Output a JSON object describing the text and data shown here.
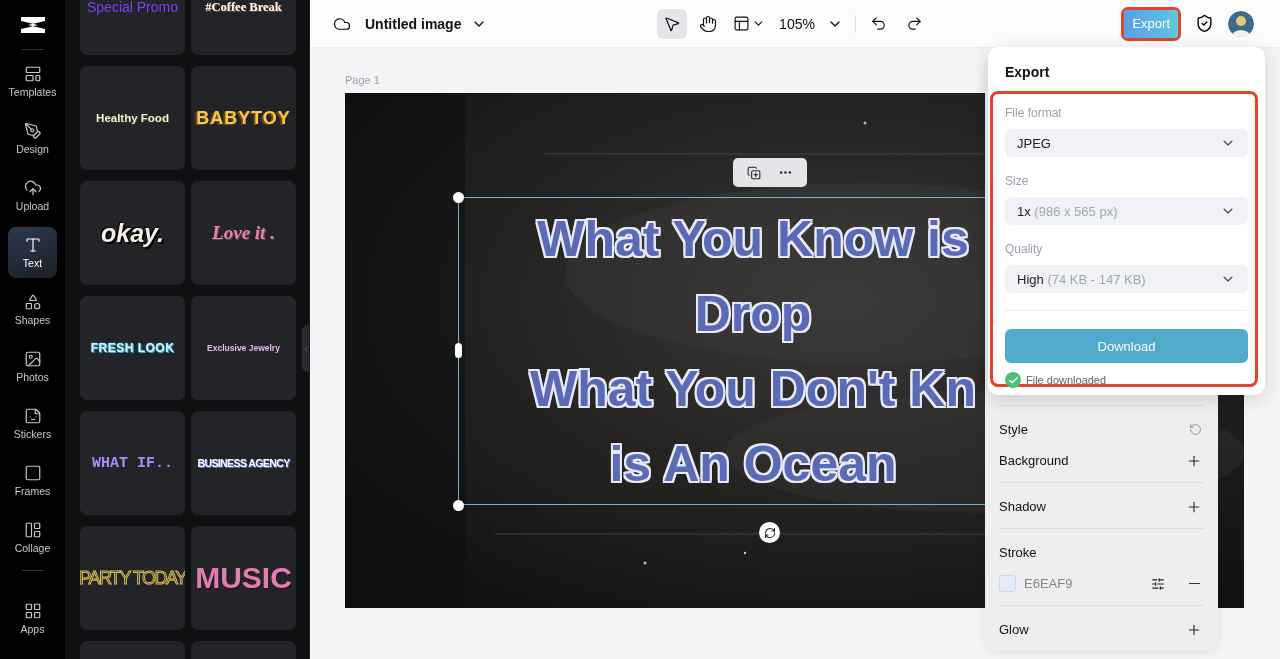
{
  "nav": {
    "items": [
      {
        "kind": "templates",
        "label": "Templates",
        "selected": false
      },
      {
        "kind": "design",
        "label": "Design",
        "selected": false
      },
      {
        "kind": "upload",
        "label": "Upload",
        "selected": false
      },
      {
        "kind": "text",
        "label": "Text",
        "selected": true
      },
      {
        "kind": "shapes",
        "label": "Shapes",
        "selected": false
      },
      {
        "kind": "photos",
        "label": "Photos",
        "selected": false
      },
      {
        "kind": "stickers",
        "label": "Stickers",
        "selected": false
      },
      {
        "kind": "frames",
        "label": "Frames",
        "selected": false
      },
      {
        "kind": "collage",
        "label": "Collage",
        "selected": false
      }
    ],
    "bottom_items": [
      {
        "kind": "apps",
        "label": "Apps",
        "selected": false
      }
    ]
  },
  "text_styles": [
    {
      "kind": "promo",
      "label": "Special Promo"
    },
    {
      "kind": "coffee",
      "label": "#Coffee Break"
    },
    {
      "kind": "healthy",
      "label": "Healthy Food"
    },
    {
      "kind": "baby",
      "label": "BABYTOY"
    },
    {
      "kind": "okay",
      "label": "okay."
    },
    {
      "kind": "love",
      "label": "Love it ."
    },
    {
      "kind": "fresh",
      "label": "FRESH LOOK"
    },
    {
      "kind": "jewelry",
      "label": "Exclusive Jewelry"
    },
    {
      "kind": "whatif",
      "label": "WHAT IF.."
    },
    {
      "kind": "business",
      "label": "BUSINESS AGENCY"
    },
    {
      "kind": "party",
      "label": "PARTY TODAY"
    },
    {
      "kind": "music",
      "label": "MUSIC"
    },
    {
      "kind": "blank"
    },
    {
      "kind": "blank"
    }
  ],
  "topbar": {
    "title": "Untitled image",
    "zoom": "105%",
    "tools": [
      {
        "kind": "pointer",
        "selected": true
      },
      {
        "kind": "hand",
        "selected": false
      }
    ],
    "export_label": "Export"
  },
  "canvas": {
    "page_label": "Page 1",
    "text_lines": [
      "What You Know is",
      "Drop",
      "What You Don't Kn",
      "is An Ocean"
    ]
  },
  "properties": {
    "groups": [
      {
        "rows": [
          {
            "kind": "reset",
            "label": "Style"
          },
          {
            "kind": "add",
            "label": "Background"
          }
        ]
      },
      {
        "rows": [
          {
            "kind": "add",
            "label": "Shadow"
          }
        ]
      },
      {
        "rows": [
          {
            "kind": "plain",
            "label": "Stroke"
          },
          {
            "kind": "color",
            "value": "E6EAF9"
          }
        ]
      },
      {
        "rows": [
          {
            "kind": "add",
            "label": "Glow"
          }
        ]
      }
    ]
  },
  "export_panel": {
    "title": "Export",
    "fields": [
      {
        "label": "File format",
        "value": "JPEG"
      },
      {
        "label": "Size",
        "value": "1x",
        "detail": "(986 x 565 px)"
      },
      {
        "label": "Quality",
        "value": "High",
        "detail": "(74 KB - 147 KB)"
      }
    ],
    "download_label": "Download",
    "status": "File downloaded"
  }
}
